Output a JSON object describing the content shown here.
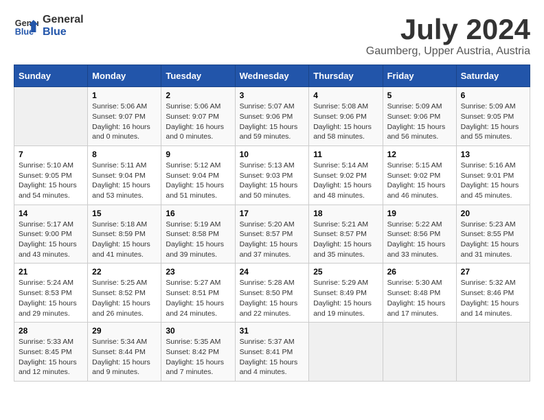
{
  "logo": {
    "text_general": "General",
    "text_blue": "Blue"
  },
  "title": "July 2024",
  "subtitle": "Gaumberg, Upper Austria, Austria",
  "calendar": {
    "headers": [
      "Sunday",
      "Monday",
      "Tuesday",
      "Wednesday",
      "Thursday",
      "Friday",
      "Saturday"
    ],
    "rows": [
      [
        {
          "day": "",
          "info": ""
        },
        {
          "day": "1",
          "info": "Sunrise: 5:06 AM\nSunset: 9:07 PM\nDaylight: 16 hours\nand 0 minutes."
        },
        {
          "day": "2",
          "info": "Sunrise: 5:06 AM\nSunset: 9:07 PM\nDaylight: 16 hours\nand 0 minutes."
        },
        {
          "day": "3",
          "info": "Sunrise: 5:07 AM\nSunset: 9:06 PM\nDaylight: 15 hours\nand 59 minutes."
        },
        {
          "day": "4",
          "info": "Sunrise: 5:08 AM\nSunset: 9:06 PM\nDaylight: 15 hours\nand 58 minutes."
        },
        {
          "day": "5",
          "info": "Sunrise: 5:09 AM\nSunset: 9:06 PM\nDaylight: 15 hours\nand 56 minutes."
        },
        {
          "day": "6",
          "info": "Sunrise: 5:09 AM\nSunset: 9:05 PM\nDaylight: 15 hours\nand 55 minutes."
        }
      ],
      [
        {
          "day": "7",
          "info": "Sunrise: 5:10 AM\nSunset: 9:05 PM\nDaylight: 15 hours\nand 54 minutes."
        },
        {
          "day": "8",
          "info": "Sunrise: 5:11 AM\nSunset: 9:04 PM\nDaylight: 15 hours\nand 53 minutes."
        },
        {
          "day": "9",
          "info": "Sunrise: 5:12 AM\nSunset: 9:04 PM\nDaylight: 15 hours\nand 51 minutes."
        },
        {
          "day": "10",
          "info": "Sunrise: 5:13 AM\nSunset: 9:03 PM\nDaylight: 15 hours\nand 50 minutes."
        },
        {
          "day": "11",
          "info": "Sunrise: 5:14 AM\nSunset: 9:02 PM\nDaylight: 15 hours\nand 48 minutes."
        },
        {
          "day": "12",
          "info": "Sunrise: 5:15 AM\nSunset: 9:02 PM\nDaylight: 15 hours\nand 46 minutes."
        },
        {
          "day": "13",
          "info": "Sunrise: 5:16 AM\nSunset: 9:01 PM\nDaylight: 15 hours\nand 45 minutes."
        }
      ],
      [
        {
          "day": "14",
          "info": "Sunrise: 5:17 AM\nSunset: 9:00 PM\nDaylight: 15 hours\nand 43 minutes."
        },
        {
          "day": "15",
          "info": "Sunrise: 5:18 AM\nSunset: 8:59 PM\nDaylight: 15 hours\nand 41 minutes."
        },
        {
          "day": "16",
          "info": "Sunrise: 5:19 AM\nSunset: 8:58 PM\nDaylight: 15 hours\nand 39 minutes."
        },
        {
          "day": "17",
          "info": "Sunrise: 5:20 AM\nSunset: 8:57 PM\nDaylight: 15 hours\nand 37 minutes."
        },
        {
          "day": "18",
          "info": "Sunrise: 5:21 AM\nSunset: 8:57 PM\nDaylight: 15 hours\nand 35 minutes."
        },
        {
          "day": "19",
          "info": "Sunrise: 5:22 AM\nSunset: 8:56 PM\nDaylight: 15 hours\nand 33 minutes."
        },
        {
          "day": "20",
          "info": "Sunrise: 5:23 AM\nSunset: 8:55 PM\nDaylight: 15 hours\nand 31 minutes."
        }
      ],
      [
        {
          "day": "21",
          "info": "Sunrise: 5:24 AM\nSunset: 8:53 PM\nDaylight: 15 hours\nand 29 minutes."
        },
        {
          "day": "22",
          "info": "Sunrise: 5:25 AM\nSunset: 8:52 PM\nDaylight: 15 hours\nand 26 minutes."
        },
        {
          "day": "23",
          "info": "Sunrise: 5:27 AM\nSunset: 8:51 PM\nDaylight: 15 hours\nand 24 minutes."
        },
        {
          "day": "24",
          "info": "Sunrise: 5:28 AM\nSunset: 8:50 PM\nDaylight: 15 hours\nand 22 minutes."
        },
        {
          "day": "25",
          "info": "Sunrise: 5:29 AM\nSunset: 8:49 PM\nDaylight: 15 hours\nand 19 minutes."
        },
        {
          "day": "26",
          "info": "Sunrise: 5:30 AM\nSunset: 8:48 PM\nDaylight: 15 hours\nand 17 minutes."
        },
        {
          "day": "27",
          "info": "Sunrise: 5:32 AM\nSunset: 8:46 PM\nDaylight: 15 hours\nand 14 minutes."
        }
      ],
      [
        {
          "day": "28",
          "info": "Sunrise: 5:33 AM\nSunset: 8:45 PM\nDaylight: 15 hours\nand 12 minutes."
        },
        {
          "day": "29",
          "info": "Sunrise: 5:34 AM\nSunset: 8:44 PM\nDaylight: 15 hours\nand 9 minutes."
        },
        {
          "day": "30",
          "info": "Sunrise: 5:35 AM\nSunset: 8:42 PM\nDaylight: 15 hours\nand 7 minutes."
        },
        {
          "day": "31",
          "info": "Sunrise: 5:37 AM\nSunset: 8:41 PM\nDaylight: 15 hours\nand 4 minutes."
        },
        {
          "day": "",
          "info": ""
        },
        {
          "day": "",
          "info": ""
        },
        {
          "day": "",
          "info": ""
        }
      ]
    ]
  }
}
